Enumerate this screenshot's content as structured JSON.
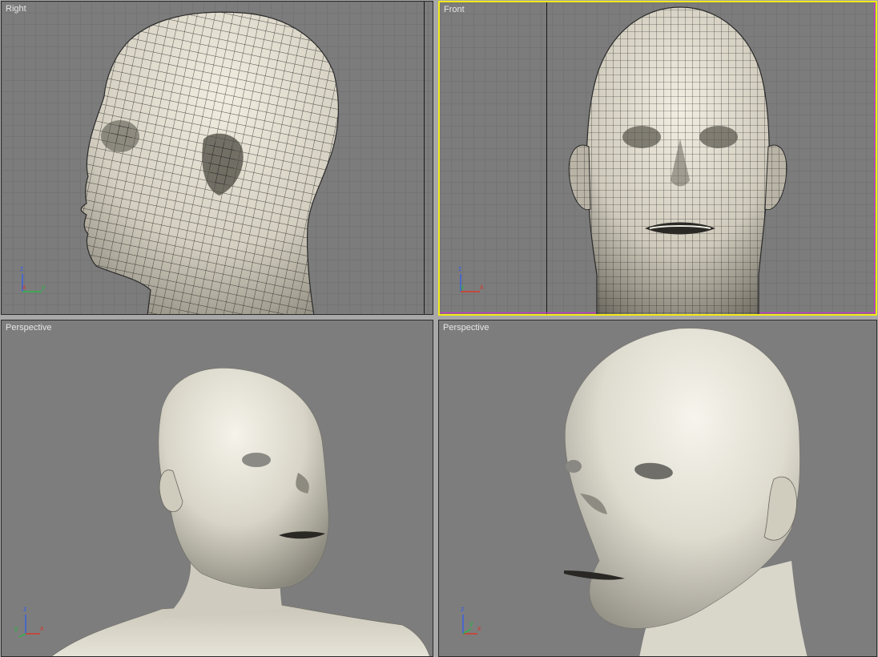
{
  "viewports": {
    "right": {
      "label": "Right",
      "active": false
    },
    "front": {
      "label": "Front",
      "active": true
    },
    "perspective_left": {
      "label": "Perspective",
      "active": false
    },
    "perspective_right": {
      "label": "Perspective",
      "active": false
    }
  },
  "axis_labels": {
    "right": {
      "vertical": "z",
      "left": "x",
      "right": "y"
    },
    "front": {
      "vertical": "z",
      "left": "y",
      "right": "x"
    },
    "perspective_left": {
      "vertical": "z",
      "left": "y",
      "right": "x"
    },
    "perspective_right": {
      "vertical": "z",
      "left": "y",
      "right": "x"
    }
  },
  "colors": {
    "active_border": "#f2ea19",
    "viewport_bg": "#7d7d7d",
    "mesh_fill": "#d8d4c6",
    "wire": "#1c1c1c",
    "axis_x": "#d63a2a",
    "axis_y": "#2fb34a",
    "axis_z": "#3860e0"
  }
}
